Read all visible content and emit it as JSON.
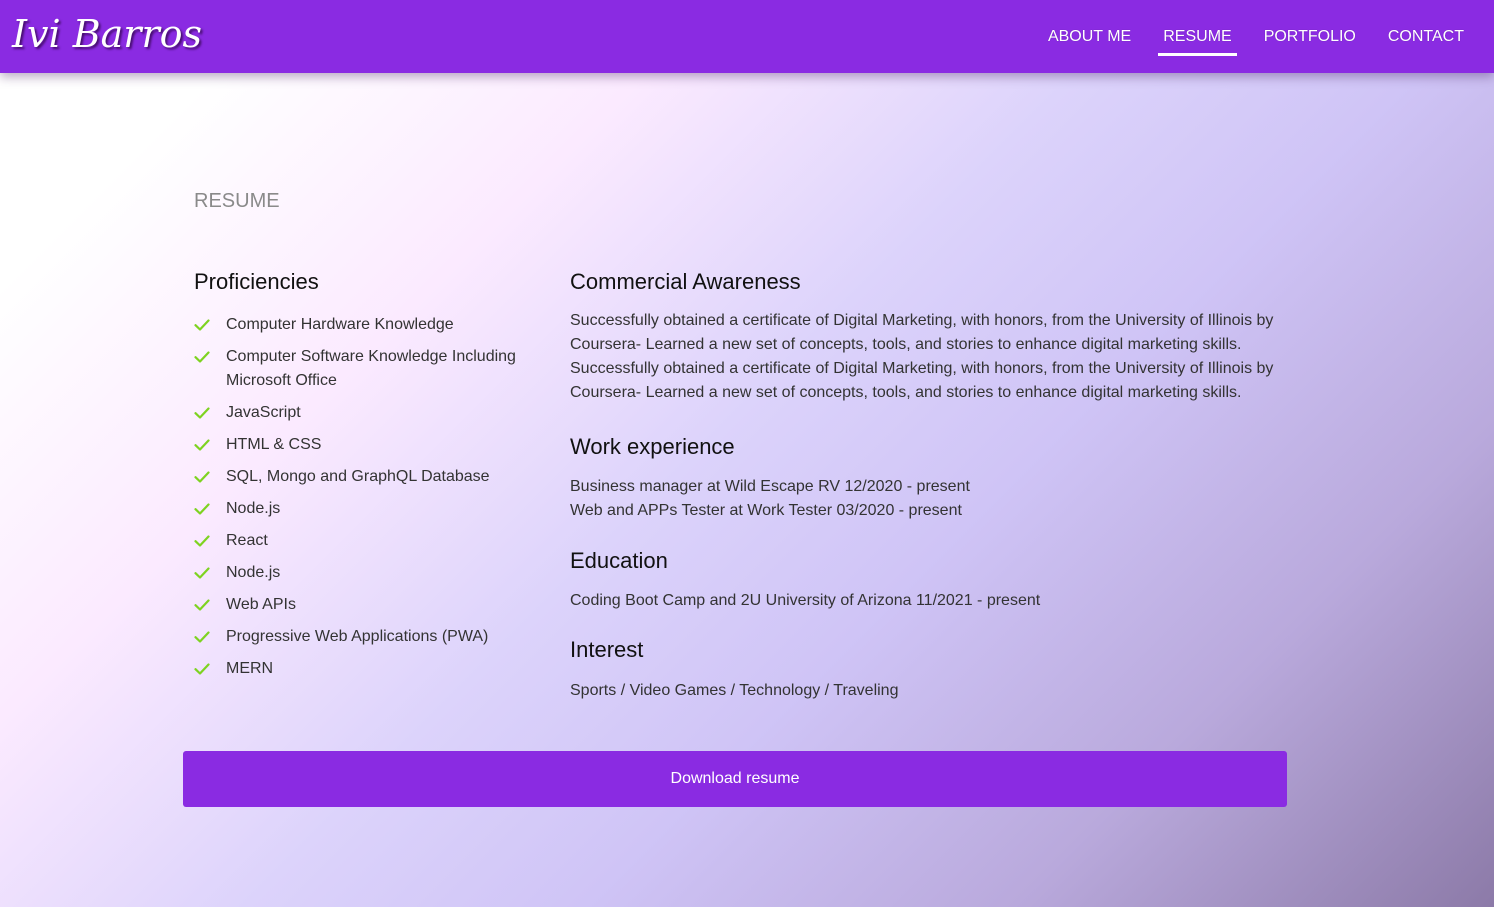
{
  "brand": "Ivi Barros",
  "nav": {
    "items": [
      {
        "label": "ABOUT ME",
        "active": false
      },
      {
        "label": "RESUME",
        "active": true
      },
      {
        "label": "PORTFOLIO",
        "active": false
      },
      {
        "label": "CONTACT",
        "active": false
      }
    ]
  },
  "page_heading": "RESUME",
  "proficiencies": {
    "title": "Proficiencies",
    "icon": "check-icon",
    "items": [
      "Computer Hardware Knowledge",
      "Computer Software Knowledge Including Microsoft Office",
      "JavaScript",
      "HTML & CSS",
      "SQL, Mongo and GraphQL Database",
      "Node.js",
      "React",
      "Node.js",
      "Web APIs",
      "Progressive Web Applications (PWA)",
      "MERN"
    ]
  },
  "commercial_awareness": {
    "title": "Commercial Awareness",
    "lines": [
      "Successfully obtained a certificate of Digital Marketing, with honors, from the University of Illinois by Coursera- Learned a new set of concepts, tools, and stories to enhance digital marketing skills.",
      "Successfully obtained a certificate of Digital Marketing, with honors, from the University of Illinois by Coursera- Learned a new set of concepts, tools, and stories to enhance digital marketing skills."
    ]
  },
  "work_experience": {
    "title": "Work experience",
    "lines": [
      "Business manager at Wild Escape RV 12/2020 - present",
      "Web and APPs Tester at Work Tester 03/2020 - present"
    ]
  },
  "education": {
    "title": "Education",
    "lines": [
      "Coding Boot Camp and 2U University of Arizona 11/2021 - present"
    ]
  },
  "interest": {
    "title": "Interest",
    "text": "Sports / Video Games / Technology / Traveling"
  },
  "download_label": "Download resume",
  "colors": {
    "brand_purple": "#8a2be2",
    "check_green": "#7ed321",
    "heading_gray": "#8a8a8a"
  }
}
